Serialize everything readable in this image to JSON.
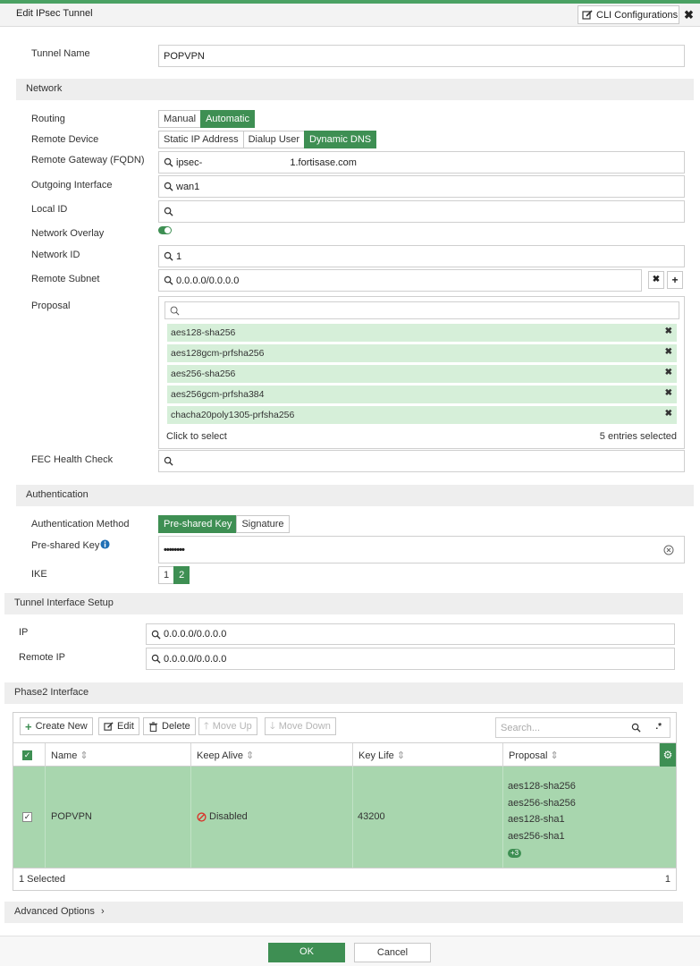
{
  "header": {
    "title": "Edit IPsec Tunnel",
    "cli_label": "CLI Configurations",
    "close": "✖"
  },
  "tunnel_name": {
    "label": "Tunnel Name",
    "value": "POPVPN"
  },
  "network": {
    "section": "Network",
    "routing": {
      "label": "Routing",
      "options": [
        "Manual",
        "Automatic"
      ],
      "selected": "Automatic"
    },
    "remote_device": {
      "label": "Remote Device",
      "options": [
        "Static IP Address",
        "Dialup User",
        "Dynamic DNS"
      ],
      "selected": "Dynamic DNS"
    },
    "remote_gateway": {
      "label": "Remote Gateway (FQDN)",
      "value_start": "ipsec-",
      "value_end": "1.fortisase.com"
    },
    "outgoing_interface": {
      "label": "Outgoing Interface",
      "value": "wan1"
    },
    "local_id": {
      "label": "Local ID",
      "value": ""
    },
    "network_overlay": {
      "label": "Network Overlay",
      "enabled": true
    },
    "network_id": {
      "label": "Network ID",
      "value": "1"
    },
    "remote_subnet": {
      "label": "Remote Subnet",
      "value": "0.0.0.0/0.0.0.0",
      "remove": "✖",
      "add": "+"
    },
    "proposal": {
      "label": "Proposal",
      "items": [
        "aes128-sha256",
        "aes128gcm-prfsha256",
        "aes256-sha256",
        "aes256gcm-prfsha384",
        "chacha20poly1305-prfsha256"
      ],
      "remove_glyph": "✖",
      "click_text": "Click to select",
      "count_text": "5 entries selected"
    },
    "fec_health_check": {
      "label": "FEC Health Check",
      "value": ""
    }
  },
  "authentication": {
    "section": "Authentication",
    "method": {
      "label": "Authentication Method",
      "options": [
        "Pre-shared Key",
        "Signature"
      ],
      "selected": "Pre-shared Key"
    },
    "psk": {
      "label": "Pre-shared Key",
      "value": "••••••••"
    },
    "ike": {
      "label": "IKE",
      "options": [
        "1",
        "2"
      ],
      "selected": "2"
    }
  },
  "tunnel_interface": {
    "section": "Tunnel Interface Setup",
    "ip": {
      "label": "IP",
      "value": "0.0.0.0/0.0.0.0"
    },
    "remote_ip": {
      "label": "Remote IP",
      "value": "0.0.0.0/0.0.0.0"
    }
  },
  "phase2": {
    "section": "Phase2 Interface",
    "toolbar": {
      "create": "Create New",
      "edit": "Edit",
      "delete": "Delete",
      "move_up": "Move Up",
      "move_down": "Move Down",
      "search_placeholder": "Search..."
    },
    "columns": [
      "Name",
      "Keep Alive",
      "Key Life",
      "Proposal"
    ],
    "rows": [
      {
        "name": "POPVPN",
        "keep_alive": "Disabled",
        "key_life": "43200",
        "proposals": [
          "aes128-sha256",
          "aes256-sha256",
          "aes128-sha1",
          "aes256-sha1"
        ],
        "more": "+3"
      }
    ],
    "footer": {
      "selected": "1 Selected",
      "count": "1"
    }
  },
  "advanced": {
    "label": "Advanced Options"
  },
  "buttons": {
    "ok": "OK",
    "cancel": "Cancel"
  },
  "colors": {
    "accent": "#3e8f53",
    "row_selected": "#a8d6ae",
    "proposal_item": "#d6efd9",
    "section": "#eeeeee",
    "disabled_icon": "#d9342b"
  }
}
